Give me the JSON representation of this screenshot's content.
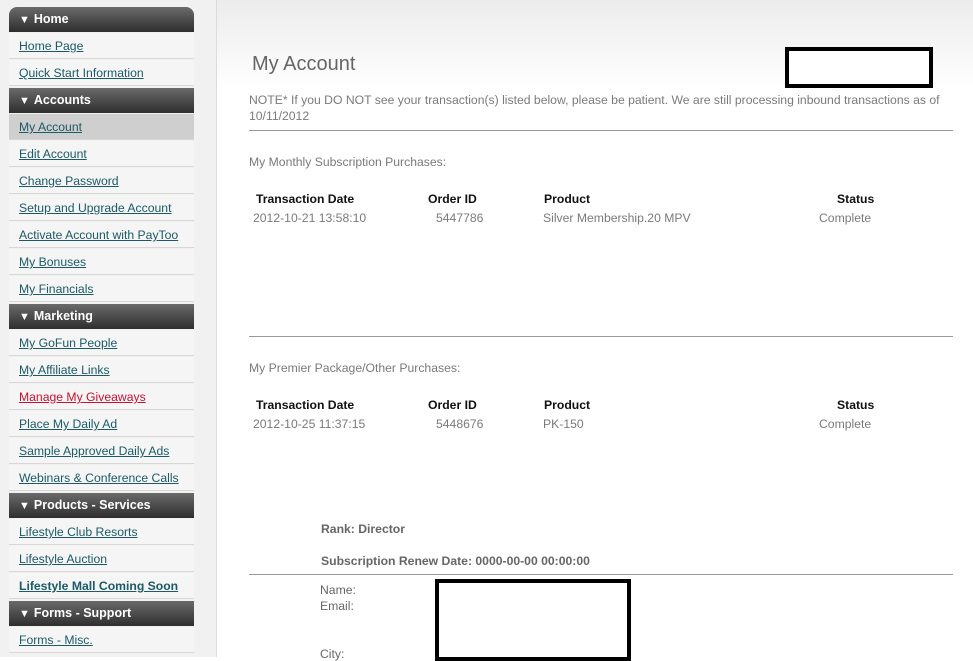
{
  "sidebar": {
    "sections": [
      {
        "title": "Home",
        "items": [
          {
            "label": "Home Page"
          },
          {
            "label": "Quick Start Information"
          }
        ]
      },
      {
        "title": "Accounts",
        "items": [
          {
            "label": "My Account"
          },
          {
            "label": "Edit Account"
          },
          {
            "label": "Change Password"
          },
          {
            "label": "Setup and Upgrade Account"
          },
          {
            "label": "Activate Account with PayToo"
          },
          {
            "label": "My Bonuses"
          },
          {
            "label": "My Financials"
          }
        ]
      },
      {
        "title": "Marketing",
        "items": [
          {
            "label": "My GoFun People"
          },
          {
            "label": "My Affiliate Links"
          },
          {
            "label": "Manage My Giveaways"
          },
          {
            "label": "Place My Daily Ad"
          },
          {
            "label": "Sample Approved Daily Ads"
          },
          {
            "label": "Webinars & Conference Calls"
          }
        ]
      },
      {
        "title": "Products - Services",
        "items": [
          {
            "label": "Lifestyle Club Resorts"
          },
          {
            "label": "Lifestyle Auction"
          },
          {
            "label": "Lifestyle Mall Coming Soon"
          }
        ]
      },
      {
        "title": "Forms - Support",
        "items": [
          {
            "label": "Forms - Misc."
          }
        ]
      }
    ]
  },
  "main": {
    "title": "My Account",
    "note": "NOTE* If you DO NOT see your transaction(s) listed below, please be patient. We are still processing inbound transactions as of 10/11/2012",
    "columns": {
      "date": "Transaction Date",
      "order": "Order ID",
      "product": "Product",
      "status": "Status"
    },
    "monthly": {
      "label": "My Monthly Subscription Purchases:",
      "rows": [
        {
          "date": "2012-10-21 13:58:10",
          "order": "5447786",
          "product": "Silver Membership.20 MPV",
          "status": "Complete"
        }
      ]
    },
    "premier": {
      "label": "My Premier Package/Other Purchases:",
      "rows": [
        {
          "date": "2012-10-25 11:37:15",
          "order": "5448676",
          "product": "PK-150",
          "status": "Complete"
        }
      ]
    },
    "rank": "Rank: Director",
    "renew": "Subscription Renew Date: 0000-00-00 00:00:00",
    "fields": {
      "name": "Name:",
      "email": "Email:",
      "city": "City:"
    }
  }
}
